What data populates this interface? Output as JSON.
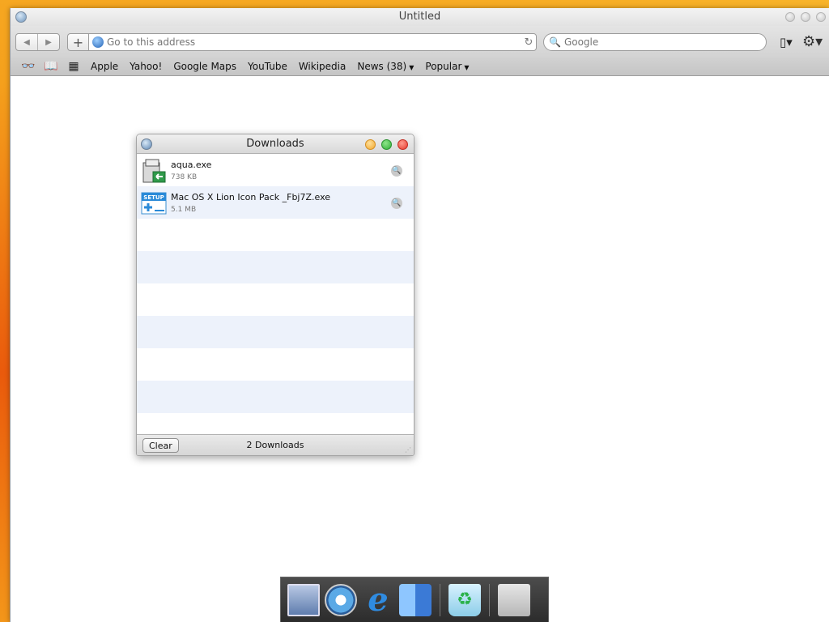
{
  "window": {
    "title": "Untitled"
  },
  "toolbar": {
    "back_icon": "◀",
    "forward_icon": "▶",
    "add_icon": "+",
    "address_placeholder": "Go to this address",
    "reload_icon": "↻",
    "search_placeholder": "Google",
    "search_icon": "🔍",
    "page_menu_icon": "▯▾",
    "settings_icon": "⚙▾"
  },
  "bookmarks_bar": {
    "reading_icon": "👓",
    "book_icon": "📖",
    "grid_icon": "▦",
    "items": [
      {
        "label": "Apple"
      },
      {
        "label": "Yahoo!"
      },
      {
        "label": "Google Maps"
      },
      {
        "label": "YouTube"
      },
      {
        "label": "Wikipedia"
      },
      {
        "label": "News (38)",
        "has_menu": true
      },
      {
        "label": "Popular",
        "has_menu": true
      }
    ],
    "caret": "▼"
  },
  "downloads": {
    "title": "Downloads",
    "items": [
      {
        "name": "aqua.exe",
        "size": "738 KB"
      },
      {
        "name": "Mac OS X Lion Icon Pack _Fbj7Z.exe",
        "size": "5.1 MB"
      }
    ],
    "reveal_icon": "🔍",
    "clear_label": "Clear",
    "count_text": "2 Downloads",
    "resize_grip": "⋰"
  },
  "dock": {
    "items": [
      "mail-icon",
      "safari-icon",
      "internet-explorer-icon",
      "finder-icon",
      "trash-icon",
      "system-preferences-icon"
    ],
    "ie_glyph": "e",
    "trash_glyph": "♻",
    "prefs_glyph": ""
  }
}
